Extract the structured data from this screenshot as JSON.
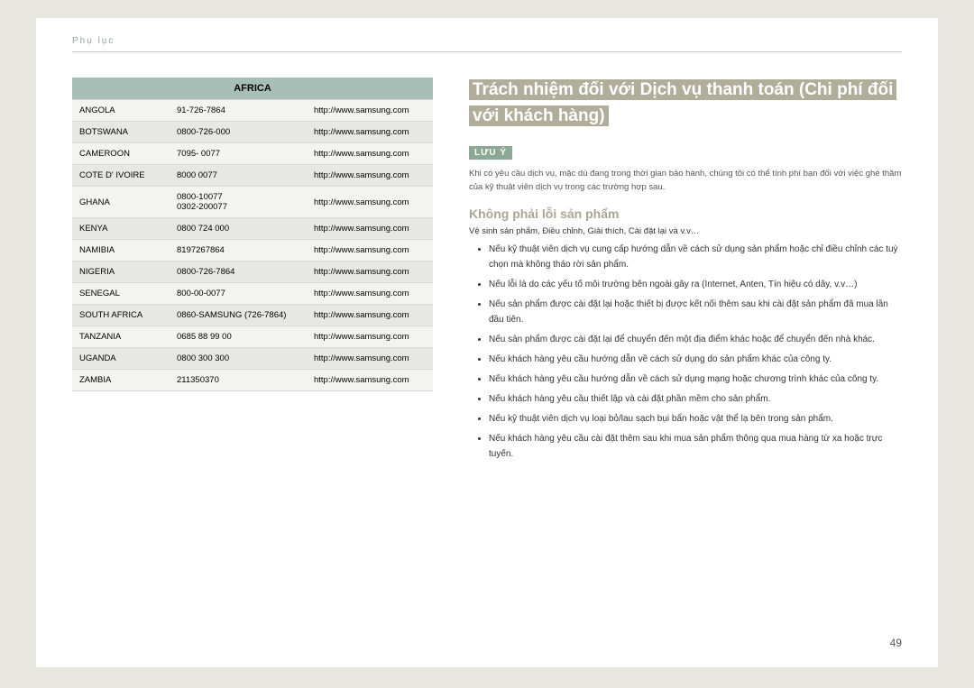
{
  "header": {
    "appendix_label": "Phụ lục"
  },
  "table": {
    "region_header": "AFRICA",
    "rows": [
      {
        "country": "ANGOLA",
        "phone": "91-726-7864",
        "url": "http://www.samsung.com"
      },
      {
        "country": "BOTSWANA",
        "phone": "0800-726-000",
        "url": "http://www.samsung.com"
      },
      {
        "country": "CAMEROON",
        "phone": "7095- 0077",
        "url": "http://www.samsung.com"
      },
      {
        "country": "COTE D' IVOIRE",
        "phone": "8000 0077",
        "url": "http://www.samsung.com"
      },
      {
        "country": "GHANA",
        "phone": "0800-10077\n0302-200077",
        "url": "http://www.samsung.com"
      },
      {
        "country": "KENYA",
        "phone": "0800 724 000",
        "url": "http://www.samsung.com"
      },
      {
        "country": "NAMIBIA",
        "phone": "8197267864",
        "url": "http://www.samsung.com"
      },
      {
        "country": "NIGERIA",
        "phone": "0800-726-7864",
        "url": "http://www.samsung.com"
      },
      {
        "country": "SENEGAL",
        "phone": "800-00-0077",
        "url": "http://www.samsung.com"
      },
      {
        "country": "SOUTH AFRICA",
        "phone": "0860-SAMSUNG (726-7864)",
        "url": "http://www.samsung.com"
      },
      {
        "country": "TANZANIA",
        "phone": "0685 88 99 00",
        "url": "http://www.samsung.com"
      },
      {
        "country": "UGANDA",
        "phone": "0800 300 300",
        "url": "http://www.samsung.com"
      },
      {
        "country": "ZAMBIA",
        "phone": "211350370",
        "url": "http://www.samsung.com"
      }
    ]
  },
  "right_panel": {
    "title": "Trách nhiệm đối với Dịch vụ thanh toán (Chi phí đối với khách hàng)",
    "note_badge": "LƯU Ý",
    "note_text": "Khi có yêu cầu dịch vụ, mặc dù đang trong thời gian bảo hành, chúng tôi có thể tính phí bạn đối với việc ghé thăm của kỹ thuật viên dịch vụ trong các trường hợp sau.",
    "subheading": "Không phải lỗi sản phẩm",
    "sub_desc": "Vệ sinh sản phẩm, Điều chỉnh, Giải thích, Cài đặt lại và v.v…",
    "bullets": [
      "Nếu kỹ thuật viên dịch vụ cung cấp hướng dẫn về cách sử dụng sản phẩm hoặc chỉ điều chỉnh các tuỳ chọn mà không tháo rời sản phẩm.",
      "Nếu lỗi là do các yếu tố môi trường bên ngoài gây ra (Internet, Anten, Tín hiệu có dây, v.v…)",
      "Nếu sản phẩm được cài đặt lại hoặc thiết bị được kết nối thêm sau khi cài đặt sản phẩm đã mua lần đầu tiên.",
      "Nếu sản phẩm được cài đặt lại để chuyển đến một địa điểm khác hoặc để chuyển đến nhà khác.",
      "Nếu khách hàng yêu cầu hướng dẫn về cách sử dụng do sản phẩm khác của công ty.",
      "Nếu khách hàng yêu cầu hướng dẫn về cách sử dụng mạng hoặc chương trình khác của công ty.",
      "Nếu khách hàng yêu cầu thiết lập và cài đặt phần mềm cho sản phẩm.",
      "Nếu kỹ thuật viên dịch vụ loại bỏ/lau sạch bụi bẩn hoặc vật thể lạ bên trong sản phẩm.",
      "Nếu khách hàng yêu cầu cài đặt thêm sau khi mua sản phẩm thông qua mua hàng từ xa hoặc trực tuyến."
    ]
  },
  "page_number": "49"
}
